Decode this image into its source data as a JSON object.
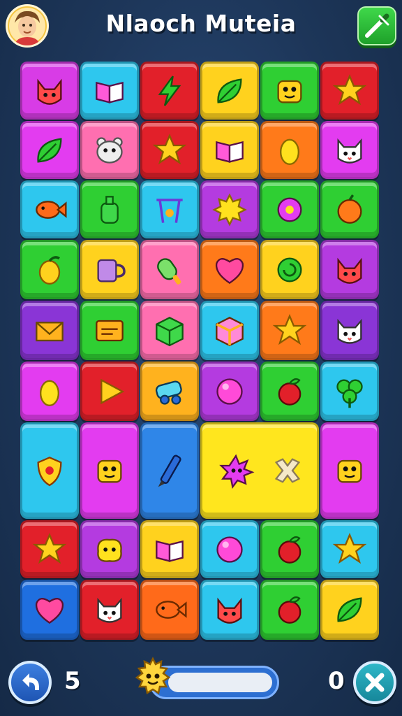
{
  "header": {
    "title": "Nlaoch Muteia",
    "avatar_icon": "player-avatar-icon",
    "hint_icon": "magic-wand-icon"
  },
  "board": {
    "tiles": [
      {
        "row": 0,
        "col": 0,
        "color": "#d83ce6",
        "icon": "fox-icon"
      },
      {
        "row": 0,
        "col": 1,
        "color": "#2ec7ee",
        "icon": "book-icon"
      },
      {
        "row": 0,
        "col": 2,
        "color": "#e2202a",
        "icon": "lightning-icon"
      },
      {
        "row": 0,
        "col": 3,
        "color": "#ffd21e",
        "icon": "leaf-icon"
      },
      {
        "row": 0,
        "col": 4,
        "color": "#2fcf33",
        "icon": "monster-icon"
      },
      {
        "row": 0,
        "col": 5,
        "color": "#e2202a",
        "icon": "star-icon"
      },
      {
        "row": 1,
        "col": 0,
        "color": "#e33cf0",
        "icon": "leaf-icon"
      },
      {
        "row": 1,
        "col": 1,
        "color": "#ff6fb0",
        "icon": "bear-icon"
      },
      {
        "row": 1,
        "col": 2,
        "color": "#e2202a",
        "icon": "star-icon"
      },
      {
        "row": 1,
        "col": 3,
        "color": "#ffd21e",
        "icon": "book-icon"
      },
      {
        "row": 1,
        "col": 4,
        "color": "#ff7a1a",
        "icon": "lemon-icon"
      },
      {
        "row": 1,
        "col": 5,
        "color": "#e33cf0",
        "icon": "cat-icon"
      },
      {
        "row": 2,
        "col": 0,
        "color": "#2ec7ee",
        "icon": "fish-icon"
      },
      {
        "row": 2,
        "col": 1,
        "color": "#2fcf33",
        "icon": "bottle-icon"
      },
      {
        "row": 2,
        "col": 2,
        "color": "#2ec7ee",
        "icon": "swing-icon"
      },
      {
        "row": 2,
        "col": 3,
        "color": "#b43be0",
        "icon": "sun-icon"
      },
      {
        "row": 2,
        "col": 4,
        "color": "#2fcf33",
        "icon": "donut-icon"
      },
      {
        "row": 2,
        "col": 5,
        "color": "#2fcf33",
        "icon": "orange-icon"
      },
      {
        "row": 3,
        "col": 0,
        "color": "#2fcf33",
        "icon": "mango-icon"
      },
      {
        "row": 3,
        "col": 1,
        "color": "#ffd21e",
        "icon": "mug-icon"
      },
      {
        "row": 3,
        "col": 2,
        "color": "#ff6fb0",
        "icon": "popsicle-icon"
      },
      {
        "row": 3,
        "col": 3,
        "color": "#ff7a1a",
        "icon": "heart-icon"
      },
      {
        "row": 3,
        "col": 4,
        "color": "#ffd21e",
        "icon": "swirl-icon"
      },
      {
        "row": 3,
        "col": 5,
        "color": "#b43be0",
        "icon": "fox-icon"
      },
      {
        "row": 4,
        "col": 0,
        "color": "#8a35d6",
        "icon": "envelope-icon"
      },
      {
        "row": 4,
        "col": 1,
        "color": "#2fcf33",
        "icon": "sign-icon"
      },
      {
        "row": 4,
        "col": 2,
        "color": "#ff6fb0",
        "icon": "cube-icon"
      },
      {
        "row": 4,
        "col": 3,
        "color": "#2ec7ee",
        "icon": "crate-icon"
      },
      {
        "row": 4,
        "col": 4,
        "color": "#ff7a1a",
        "icon": "star-icon"
      },
      {
        "row": 4,
        "col": 5,
        "color": "#8a35d6",
        "icon": "cat-icon"
      },
      {
        "row": 5,
        "col": 0,
        "color": "#e33cf0",
        "icon": "lemon-icon"
      },
      {
        "row": 5,
        "col": 1,
        "color": "#e2202a",
        "icon": "play-icon"
      },
      {
        "row": 5,
        "col": 2,
        "color": "#ffb21e",
        "icon": "cannon-icon"
      },
      {
        "row": 5,
        "col": 3,
        "color": "#b43be0",
        "icon": "ball-icon"
      },
      {
        "row": 5,
        "col": 4,
        "color": "#2fcf33",
        "icon": "apple-icon"
      },
      {
        "row": 5,
        "col": 5,
        "color": "#2ec7ee",
        "icon": "clover-icon"
      },
      {
        "row": 6,
        "col": 0,
        "color": "#2ec7ee",
        "icon": "shield-icon",
        "tall": true
      },
      {
        "row": 6,
        "col": 1,
        "color": "#e33cf0",
        "icon": "monster-icon",
        "tall": true
      },
      {
        "row": 6,
        "col": 2,
        "color": "#2f86e8",
        "icon": "pen-icon",
        "tall": true
      },
      {
        "row": 6,
        "col": 3,
        "color": "#ffe61e",
        "icon": "spiky-icon",
        "tall": true,
        "wide": true,
        "icon2": "x-shape-icon"
      },
      {
        "row": 6,
        "col": 5,
        "color": "#e33cf0",
        "icon": "monster-icon",
        "tall": true
      },
      {
        "row": 7,
        "col": 0,
        "color": "#e2202a",
        "icon": "star-icon"
      },
      {
        "row": 7,
        "col": 1,
        "color": "#b43be0",
        "icon": "blob-icon"
      },
      {
        "row": 7,
        "col": 2,
        "color": "#ffd21e",
        "icon": "book-icon"
      },
      {
        "row": 7,
        "col": 3,
        "color": "#2ec7ee",
        "icon": "ball-icon"
      },
      {
        "row": 7,
        "col": 4,
        "color": "#2fcf33",
        "icon": "apple-icon"
      },
      {
        "row": 7,
        "col": 5,
        "color": "#2ec7ee",
        "icon": "star-icon"
      },
      {
        "row": 8,
        "col": 0,
        "color": "#1f6fe0",
        "icon": "heart-icon"
      },
      {
        "row": 8,
        "col": 1,
        "color": "#e2202a",
        "icon": "cat-icon"
      },
      {
        "row": 8,
        "col": 2,
        "color": "#ff6a1a",
        "icon": "fish-icon"
      },
      {
        "row": 8,
        "col": 3,
        "color": "#2ec7ee",
        "icon": "fox-icon"
      },
      {
        "row": 8,
        "col": 4,
        "color": "#2fcf33",
        "icon": "apple-icon"
      },
      {
        "row": 8,
        "col": 5,
        "color": "#ffd21e",
        "icon": "leaf-icon"
      }
    ]
  },
  "footer": {
    "undo_icon": "undo-arrow-icon",
    "moves_left": "5",
    "progress": 0.0,
    "progress_mascot_icon": "mascot-icon",
    "score": "0",
    "close_icon": "close-icon"
  }
}
